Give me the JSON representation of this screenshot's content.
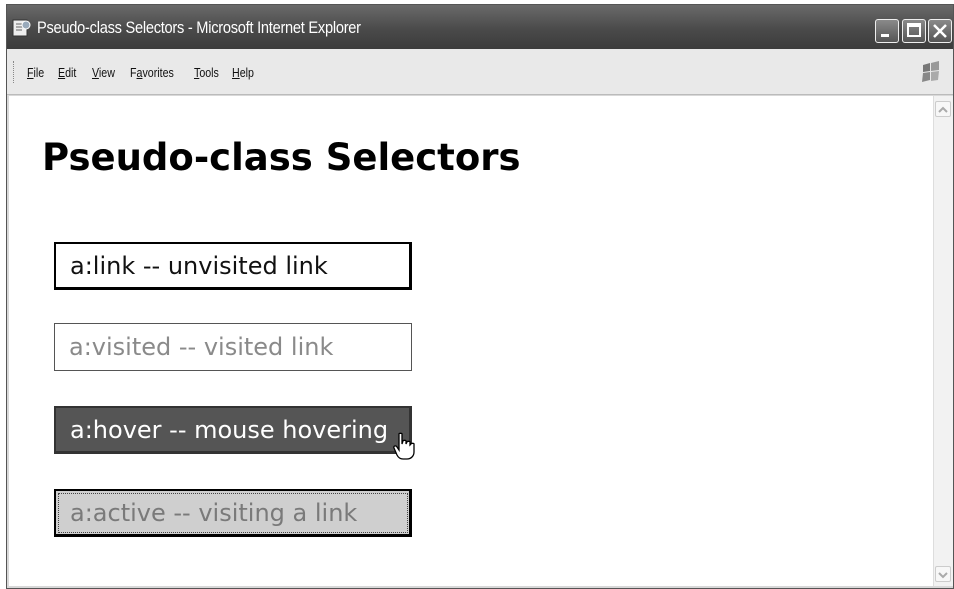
{
  "window": {
    "title": "Pseudo-class Selectors - Microsoft Internet Explorer",
    "icons": {
      "app": "ie-page-icon",
      "minimize": "minimize-icon",
      "maximize": "maximize-icon",
      "close": "close-icon",
      "logo": "windows-flag-icon"
    }
  },
  "menubar": {
    "items": [
      {
        "label": "File",
        "mnemonic": "F"
      },
      {
        "label": "Edit",
        "mnemonic": "E"
      },
      {
        "label": "View",
        "mnemonic": "V"
      },
      {
        "label": "Favorites",
        "mnemonic": "a"
      },
      {
        "label": "Tools",
        "mnemonic": "T"
      },
      {
        "label": "Help",
        "mnemonic": "H"
      }
    ]
  },
  "page": {
    "heading": "Pseudo-class Selectors",
    "links": [
      {
        "label": "a:link -- unvisited link",
        "state": "link"
      },
      {
        "label": "a:visited -- visited link",
        "state": "visited"
      },
      {
        "label": "a:hover -- mouse hovering",
        "state": "hover"
      },
      {
        "label": "a:active -- visiting a link",
        "state": "active"
      }
    ],
    "cursor": "hand-pointer-icon"
  },
  "colors": {
    "titlebar": "#4a4a4a",
    "link_text": "#111111",
    "visited_text": "#8a8a8a",
    "hover_bg": "#555555",
    "hover_text": "#ffffff",
    "active_bg": "#cfcfcf",
    "active_text": "#7a7a7a"
  }
}
